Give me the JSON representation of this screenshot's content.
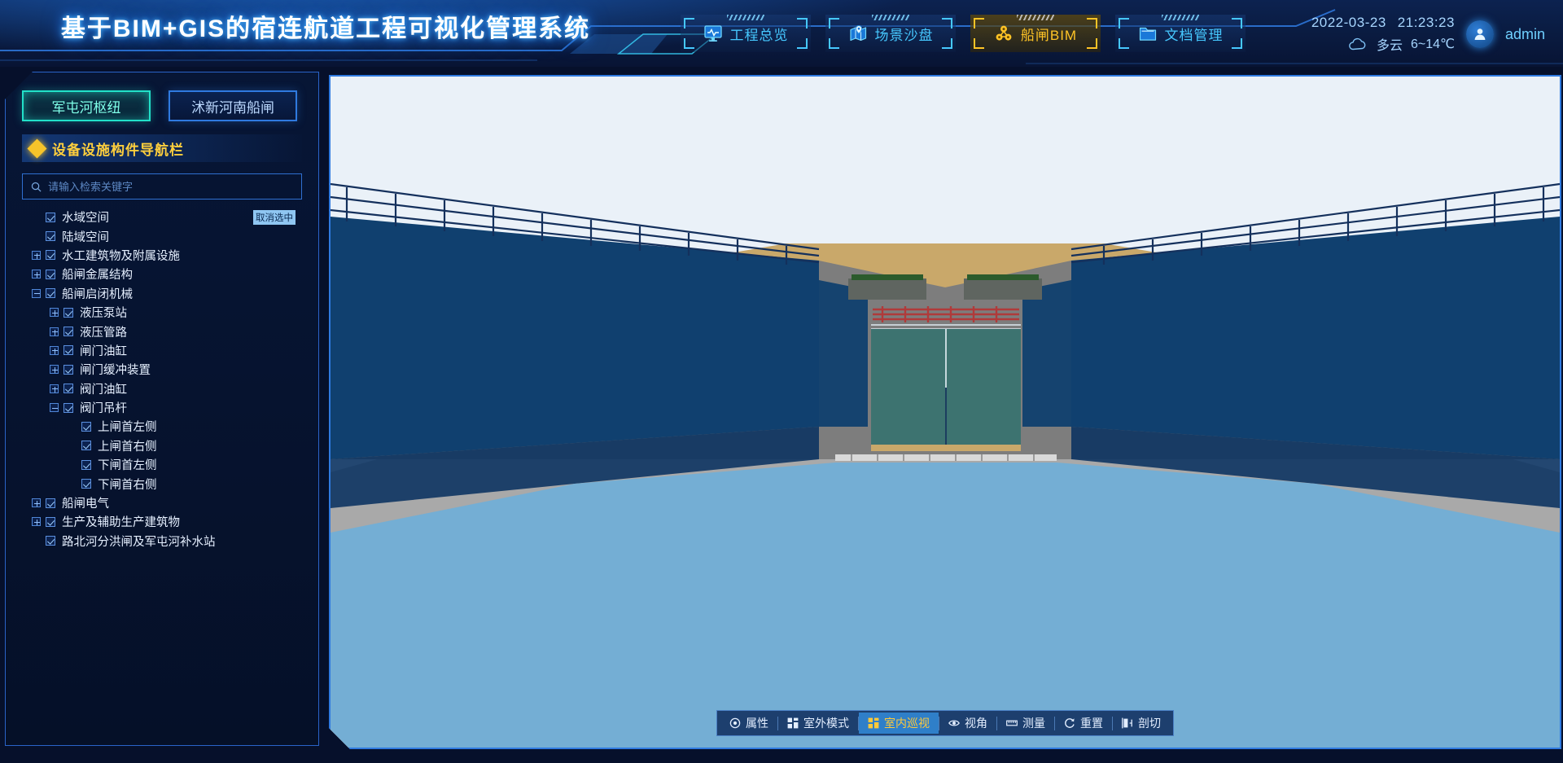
{
  "header": {
    "title": "基于BIM+GIS的宿连航道工程可视化管理系统",
    "tabs": [
      {
        "label": "工程总览",
        "icon": "monitor-pulse-icon",
        "active": false
      },
      {
        "label": "场景沙盘",
        "icon": "map-pin-icon",
        "active": false
      },
      {
        "label": "船闸BIM",
        "icon": "molecule-icon",
        "active": true
      },
      {
        "label": "文档管理",
        "icon": "folder-icon",
        "active": false
      }
    ],
    "date": "2022-03-23",
    "time": "21:23:23",
    "weather": "多云",
    "temperature": "6~14℃",
    "weather_icon": "cloud-icon",
    "user": "admin",
    "accent_active": "#ffc426",
    "accent": "#46c8ff"
  },
  "sidebar": {
    "tabs": [
      {
        "label": "军屯河枢纽",
        "active": true
      },
      {
        "label": "沭新河南船闸",
        "active": false
      }
    ],
    "section_title": "设备设施构件导航栏",
    "search_placeholder": "请输入检索关键字",
    "search_value": "",
    "deselect_badge": "取消选中",
    "tree": [
      {
        "label": "水域空间",
        "level": 0,
        "expander": "none",
        "checked": true,
        "badge": true
      },
      {
        "label": "陆域空间",
        "level": 0,
        "expander": "none",
        "checked": true
      },
      {
        "label": "水工建筑物及附属设施",
        "level": 0,
        "expander": "plus",
        "checked": true
      },
      {
        "label": "船闸金属结构",
        "level": 0,
        "expander": "plus",
        "checked": true
      },
      {
        "label": "船闸启闭机械",
        "level": 0,
        "expander": "minus",
        "checked": true
      },
      {
        "label": "液压泵站",
        "level": 1,
        "expander": "plus",
        "checked": true
      },
      {
        "label": "液压管路",
        "level": 1,
        "expander": "plus",
        "checked": true
      },
      {
        "label": "闸门油缸",
        "level": 1,
        "expander": "plus",
        "checked": true
      },
      {
        "label": "闸门缓冲装置",
        "level": 1,
        "expander": "plus",
        "checked": true
      },
      {
        "label": "阀门油缸",
        "level": 1,
        "expander": "plus",
        "checked": true
      },
      {
        "label": "阀门吊杆",
        "level": 1,
        "expander": "minus",
        "checked": true
      },
      {
        "label": "上闸首左侧",
        "level": 2,
        "expander": "none",
        "checked": true
      },
      {
        "label": "上闸首右侧",
        "level": 2,
        "expander": "none",
        "checked": true
      },
      {
        "label": "下闸首左侧",
        "level": 2,
        "expander": "none",
        "checked": true
      },
      {
        "label": "下闸首右侧",
        "level": 2,
        "expander": "none",
        "checked": true
      },
      {
        "label": "船闸电气",
        "level": 0,
        "expander": "plus",
        "checked": true
      },
      {
        "label": "生产及辅助生产建筑物",
        "level": 0,
        "expander": "plus",
        "checked": true
      },
      {
        "label": "路北河分洪闸及军屯河补水站",
        "level": 0,
        "expander": "none",
        "checked": true
      }
    ]
  },
  "viewport": {
    "toolbar": [
      {
        "label": "属性",
        "icon": "target-icon",
        "active": false
      },
      {
        "label": "室外模式",
        "icon": "grid-icon",
        "active": false
      },
      {
        "label": "室内巡视",
        "icon": "grid-icon",
        "active": true
      },
      {
        "label": "视角",
        "icon": "eye-icon",
        "active": false
      },
      {
        "label": "测量",
        "icon": "ruler-icon",
        "active": false
      },
      {
        "label": "重置",
        "icon": "refresh-icon",
        "active": false
      },
      {
        "label": "剖切",
        "icon": "section-cut-icon",
        "active": false
      }
    ],
    "scene": {
      "description": "船闸三维室内巡视视图",
      "colors": {
        "sky": "#eaf1f8",
        "wall_navy": "#10406f",
        "wall_navy_dark": "#0d3462",
        "concrete_grey": "#7d7d7d",
        "concrete_light": "#a9a9a9",
        "embankment_tan": "#c9a86a",
        "gate_teal": "#3d7370",
        "water_blue": "#74aed4",
        "railing": "#14305c",
        "railing_red": "#b03a3a"
      }
    }
  }
}
